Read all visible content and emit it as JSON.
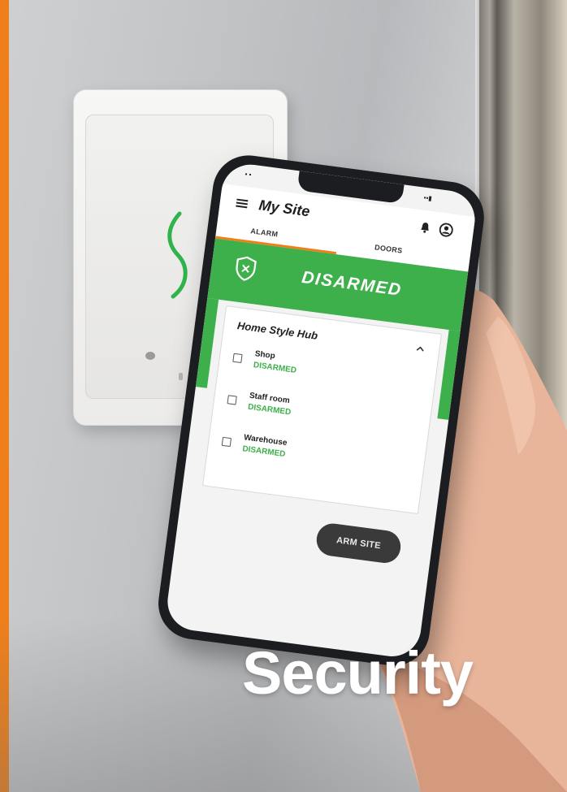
{
  "app": {
    "title": "My Site",
    "tabs": [
      {
        "label": "ALARM",
        "active": true
      },
      {
        "label": "DOORS",
        "active": false
      }
    ],
    "status": "DISARMED",
    "hub": {
      "name": "Home Style Hub",
      "zones": [
        {
          "name": "Shop",
          "status": "DISARMED"
        },
        {
          "name": "Staff room",
          "status": "DISARMED"
        },
        {
          "name": "Warehouse",
          "status": "DISARMED"
        }
      ]
    },
    "arm_button": "ARM SITE"
  },
  "headline": "Security",
  "colors": {
    "brand_orange": "#f07f1a",
    "status_green": "#3db04b",
    "button_dark": "#3a3a3a"
  }
}
